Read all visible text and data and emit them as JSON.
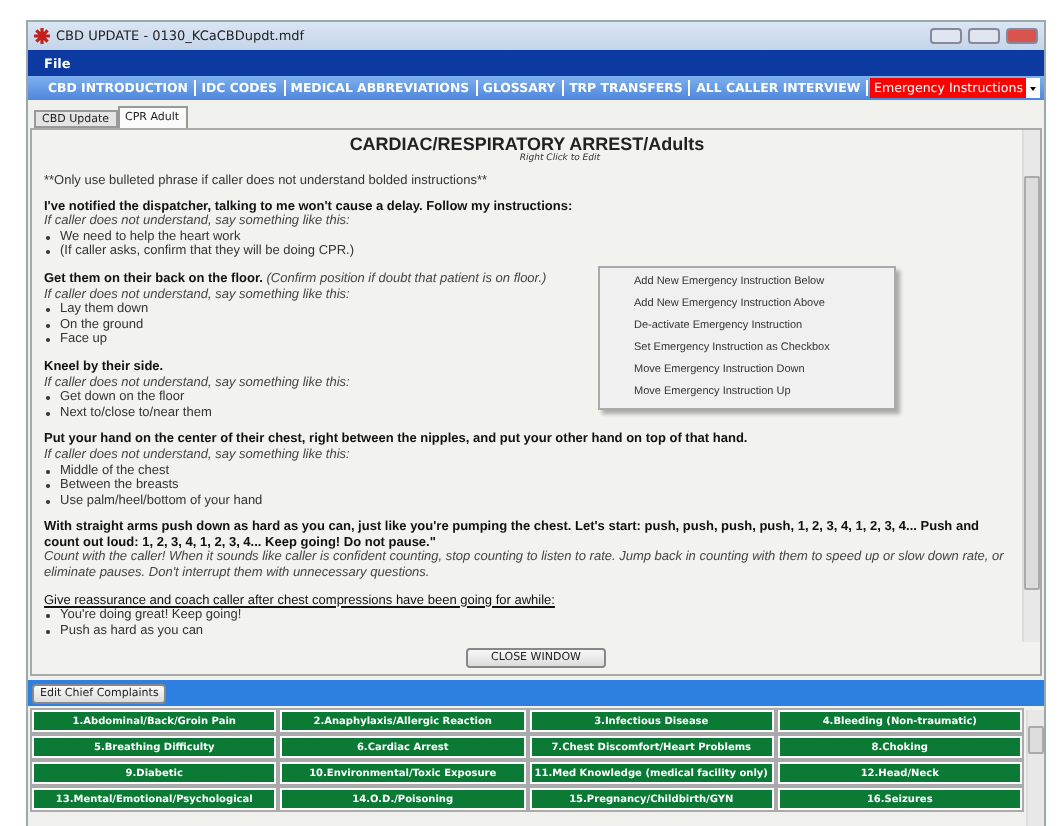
{
  "window": {
    "title": "CBD UPDATE - 0130_KCaCBDupdt.mdf"
  },
  "menu": [
    "File"
  ],
  "toolbar": {
    "links": [
      "CBD INTRODUCTION",
      "IDC CODES",
      "MEDICAL ABBREVIATIONS",
      "GLOSSARY",
      "TRP TRANSFERS",
      "ALL CALLER INTERVIEW"
    ],
    "dropdown": "Emergency Instructions"
  },
  "tabs": [
    {
      "label": "CBD Update",
      "selected": false
    },
    {
      "label": "CPR Adult",
      "selected": true
    }
  ],
  "document": {
    "title": "CARDIAC/RESPIRATORY ARREST/Adults",
    "hint": "Right Click to Edit",
    "note": "**Only use bulleted phrase if caller does not understand bolded instructions**",
    "sections": [
      {
        "kind": "bold",
        "heading": "I've notified the dispatcher, talking to me won't cause a delay.  Follow my instructions:",
        "prompt": "If caller does not understand, say something like this:",
        "bullets": [
          "We need to help the heart work",
          "(If caller asks, confirm that they will be doing CPR.)"
        ]
      },
      {
        "kind": "bold",
        "heading": "Get them on their back on the floor.",
        "aside": "(Confirm position if doubt that patient is on floor.)",
        "prompt": "If caller does not understand, say something like this:",
        "bullets": [
          "Lay them down",
          "On the ground",
          "Face up"
        ]
      },
      {
        "kind": "bold",
        "heading": "Kneel by their side.",
        "prompt": "If caller does not understand, say something like this:",
        "bullets": [
          "Get down on the floor",
          "Next to/close to/near them"
        ]
      },
      {
        "kind": "bold",
        "heading": "Put your hand on the center of their chest, right between the nipples, and put your other hand on top of that hand.",
        "prompt": "If caller does not understand, say something like this:",
        "bullets": [
          "Middle of the chest",
          "Between the breasts",
          "Use palm/heel/bottom of your hand"
        ]
      },
      {
        "kind": "bold",
        "heading": "With straight arms push down as hard as you can, just like you're pumping the chest.  Let's start: push, push, push, push, 1, 2, 3, 4, 1, 2, 3, 4...  Push and count out loud: 1, 2, 3, 4, 1, 2, 3, 4...  Keep going!  Do not pause.\"",
        "prompt": "Count with the caller!  When it sounds like caller is confident counting, stop counting to listen to rate.  Jump back in counting with them to speed up or slow down rate, or eliminate pauses.  Don't interrupt them with unnecessary questions."
      },
      {
        "kind": "underlined",
        "heading": "Give reassurance and coach caller after chest compressions have been going for awhile:",
        "bullets": [
          "You're doing great! Keep going!",
          "Push as hard as you can"
        ]
      }
    ]
  },
  "context_menu": [
    "Add New Emergency Instruction Below",
    "Add New Emergency Instruction Above",
    "De-activate Emergency Instruction",
    "Set Emergency Instruction as Checkbox",
    "Move Emergency Instruction Down",
    "Move Emergency Instruction Up"
  ],
  "close_button": "CLOSE WINDOW",
  "edit_button": "Edit Chief Complaints",
  "complaints": [
    "1.Abdominal/Back/Groin Pain",
    "2.Anaphylaxis/Allergic Reaction",
    "3.Infectious Disease",
    "4.Bleeding (Non-traumatic)",
    "5.Breathing Difficulty",
    "6.Cardiac Arrest",
    "7.Chest Discomfort/Heart Problems",
    "8.Choking",
    "9.Diabetic",
    "10.Environmental/Toxic Exposure",
    "11.Med Knowledge (medical facility only)",
    "12.Head/Neck",
    "13.Mental/Emotional/Psychological",
    "14.O.D./Poisoning",
    "15.Pregnancy/Childbirth/GYN",
    "16.Seizures"
  ]
}
